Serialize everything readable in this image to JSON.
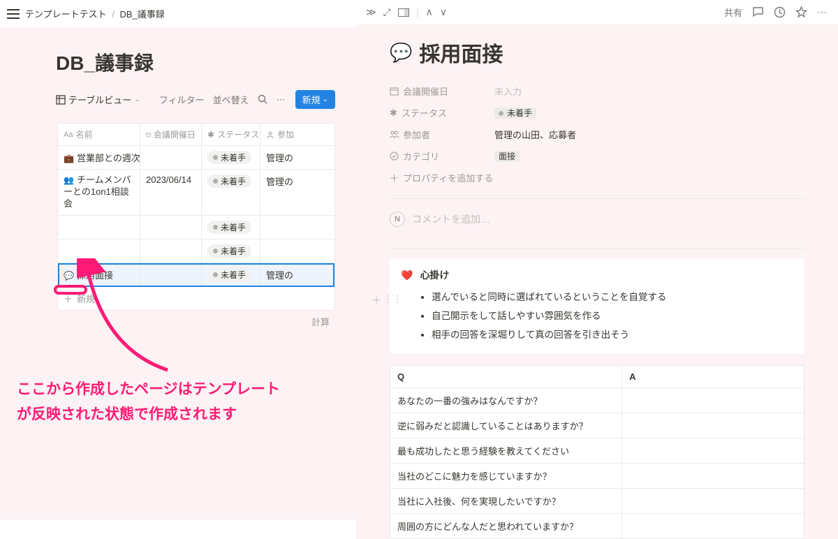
{
  "breadcrumb": {
    "parent": "テンプレートテスト",
    "current": "DB_議事録"
  },
  "db": {
    "title": "DB_議事録",
    "view_label": "テーブルビュー",
    "filter_label": "フィルター",
    "sort_label": "並べ替え",
    "new_button": "新規",
    "columns": {
      "name": "名前",
      "date": "会議開催日",
      "status": "ステータス",
      "participants": "参加"
    },
    "name_prefix": "Aa",
    "rows": [
      {
        "icon": "💼",
        "name": "営業部との週次定例",
        "date": "",
        "status": "未着手",
        "participants": "管理の"
      },
      {
        "icon": "👥",
        "name": "チームメンバーとの1on1相談会",
        "date": "2023/06/14",
        "status": "未着手",
        "participants": "管理の"
      },
      {
        "icon": "",
        "name": "",
        "date": "",
        "status": "未着手",
        "participants": ""
      },
      {
        "icon": "",
        "name": "",
        "date": "",
        "status": "未着手",
        "participants": ""
      },
      {
        "icon": "💬",
        "name": "採用面接",
        "date": "",
        "status": "未着手",
        "participants": "管理の"
      }
    ],
    "new_row_label": "新規",
    "calc_label": "計算"
  },
  "annotation": {
    "line1": "ここから作成したページはテンプレート",
    "line2": "が反映された状態で作成されます"
  },
  "right_topbar": {
    "share": "共有"
  },
  "page": {
    "icon": "💬",
    "title": "採用面接",
    "props": {
      "date_label": "会議開催日",
      "date_value": "未入力",
      "status_label": "ステータス",
      "status_value": "未着手",
      "participants_label": "参加者",
      "participants_value": "管理の山田、応募者",
      "category_label": "カテゴリ",
      "category_value": "面接",
      "add_prop": "プロパティを追加する"
    },
    "comment_placeholder": "コメントを追加…",
    "comment_avatar_letter": "N",
    "callout": {
      "icon": "❤️",
      "title": "心掛け",
      "items": [
        "選んでいると同時に選ばれているということを自覚する",
        "自己開示をして話しやすい雰囲気を作る",
        "相手の回答を深堀りして真の回答を引き出そう"
      ]
    },
    "qa": {
      "header_q": "Q",
      "header_a": "A",
      "rows": [
        "あなたの一番の強みはなんですか？",
        "逆に弱みだと認識していることはありますか？",
        "最も成功したと思う経験を教えてください",
        "当社のどこに魅力を感じていますか？",
        "当社に入社後、何を実現したいですか？",
        "周囲の方にどんな人だと思われていますか？"
      ]
    }
  }
}
